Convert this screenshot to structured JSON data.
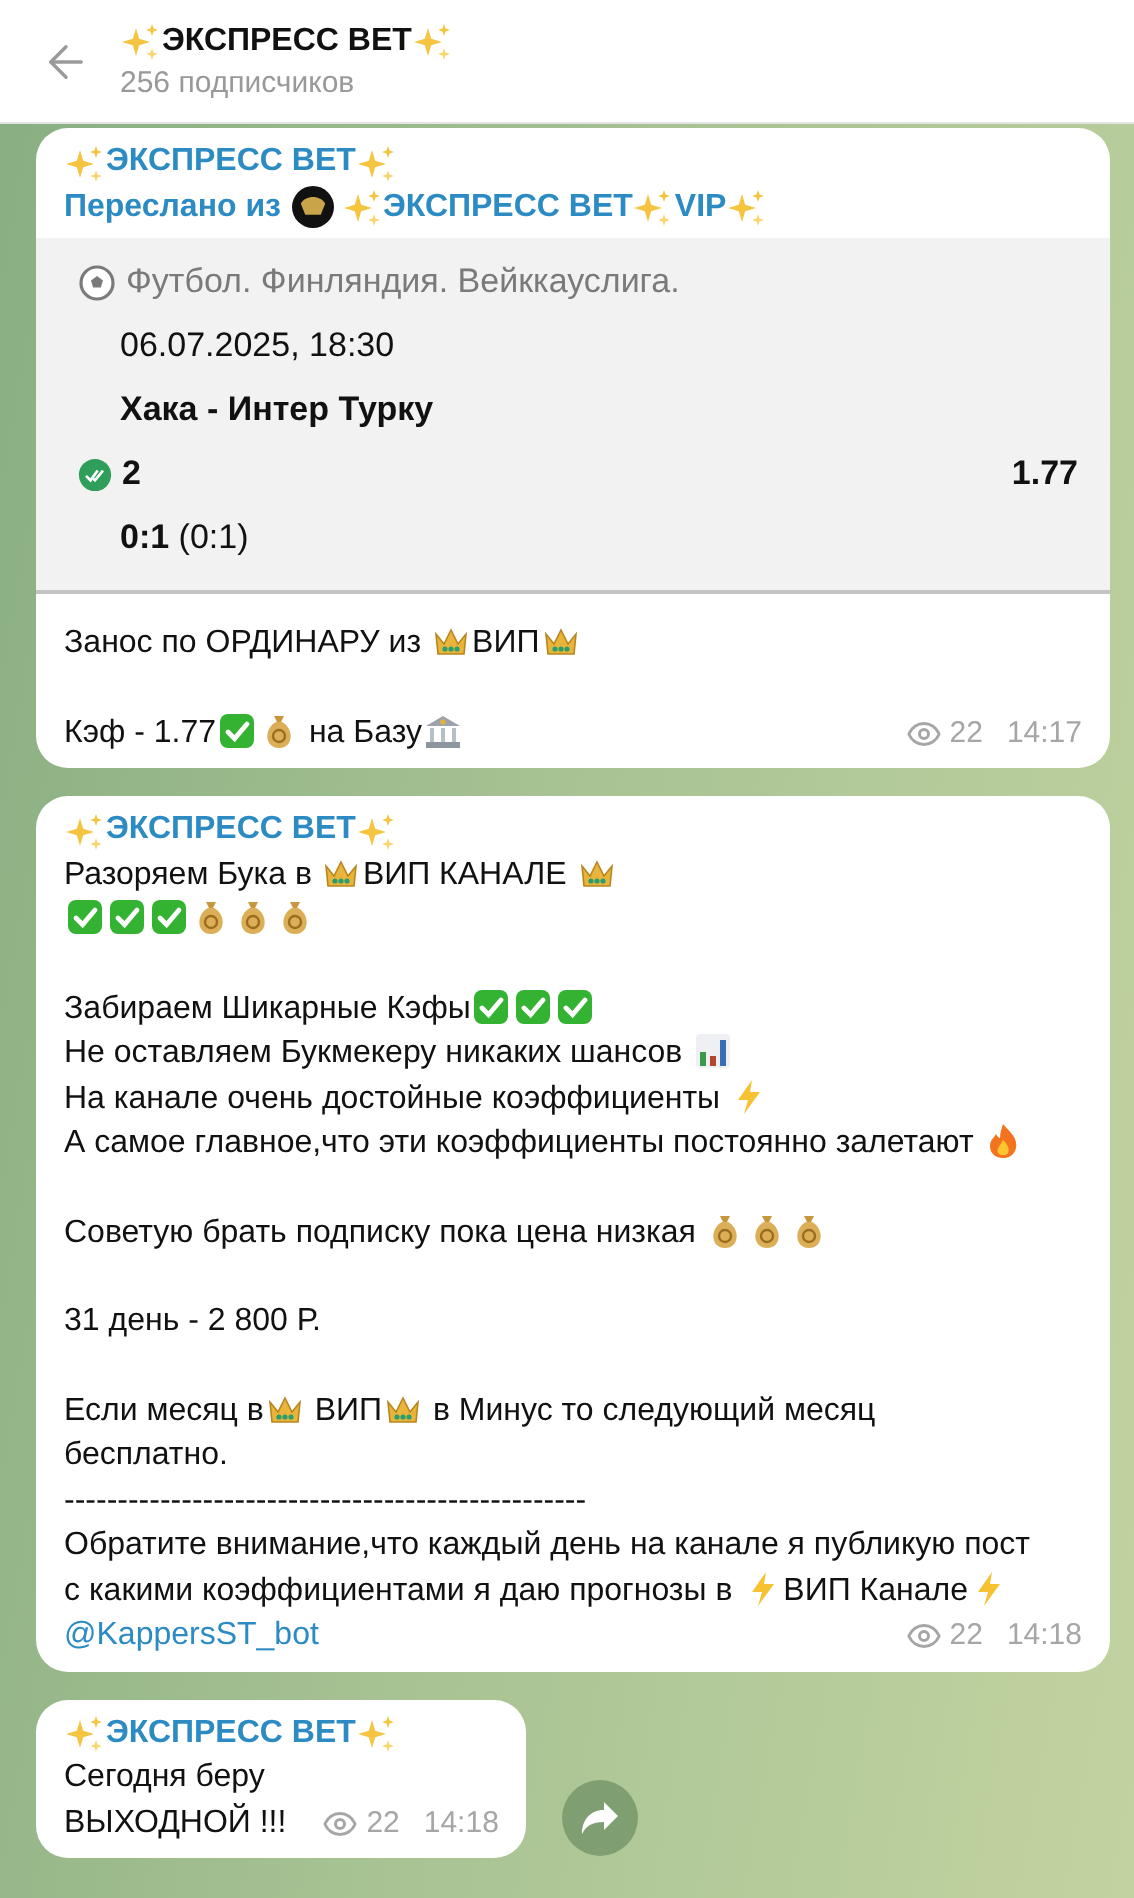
{
  "header": {
    "title": [
      {
        "kind": "sparkles"
      },
      " ЭКСПРЕСС ВЕТ",
      {
        "kind": "sparkles"
      }
    ],
    "subtitle": "256 подписчиков"
  },
  "messages": [
    {
      "author": [
        {
          "kind": "sparkles"
        },
        " ЭКСПРЕСС ВЕТ",
        {
          "kind": "sparkles"
        }
      ],
      "forwarded": {
        "label": "Переслано из",
        "source": [
          {
            "kind": "sparkles"
          },
          " ЭКСПРЕСС ВЕТ ",
          {
            "kind": "sparkles"
          },
          "VIP ",
          {
            "kind": "sparkles"
          }
        ]
      },
      "bet": {
        "league": "Футбол. Финляндия. Вейккауслига.",
        "date": "06.07.2025, 18:30",
        "match": "Хака - Интер Турку",
        "pick": "2",
        "odds": "1.77",
        "score": "**0:1** (0:1)"
      },
      "paragraphs": [
        [
          [
            "Занос по ОРДИНАРУ из ",
            {
              "kind": "crown"
            },
            "ВИП",
            {
              "kind": "crown"
            }
          ]
        ],
        [
          [
            "Кэф - 1.77",
            {
              "kind": "check"
            },
            {
              "kind": "moneybag"
            },
            " на Базу",
            {
              "kind": "bank"
            }
          ]
        ]
      ],
      "views": "22",
      "time": "14:17"
    },
    {
      "author": [
        {
          "kind": "sparkles"
        },
        " ЭКСПРЕСС ВЕТ",
        {
          "kind": "sparkles"
        }
      ],
      "paragraphs": [
        [
          [
            "Разоряем Бука в ",
            {
              "kind": "crown"
            },
            "ВИП КАНАЛЕ ",
            {
              "kind": "crown"
            }
          ],
          [
            {
              "kind": "check"
            },
            {
              "kind": "check"
            },
            {
              "kind": "check"
            },
            {
              "kind": "moneybag"
            },
            {
              "kind": "moneybag"
            },
            {
              "kind": "moneybag"
            }
          ]
        ],
        [
          [
            "Забираем Шикарные Кэфы",
            {
              "kind": "check"
            },
            {
              "kind": "check"
            },
            {
              "kind": "check"
            }
          ],
          [
            "Не оставляем Букмекеру никаких шансов ",
            {
              "kind": "chart"
            }
          ],
          [
            "На канале очень достойные коэффициенты ",
            {
              "kind": "zap"
            }
          ],
          [
            "А самое главное,что эти коэффициенты постоянно залетают ",
            {
              "kind": "fire"
            }
          ]
        ],
        [
          [
            "Советую брать подписку пока цена низкая ",
            {
              "kind": "moneybag"
            },
            {
              "kind": "moneybag"
            },
            {
              "kind": "moneybag"
            }
          ]
        ],
        [
          [
            "31 день - 2 800 Р."
          ]
        ],
        [
          [
            "Если месяц в",
            {
              "kind": "crown"
            },
            " ВИП",
            {
              "kind": "crown"
            },
            " в Минус то следующий месяц"
          ],
          [
            "бесплатно."
          ],
          [
            "-------------------------------------------------"
          ],
          [
            "Обратите внимание,что каждый день на канале я публикую пост"
          ],
          [
            "с какими коэффициентами я даю прогнозы в ",
            {
              "kind": "zap"
            },
            "ВИП Канале",
            {
              "kind": "zap"
            }
          ],
          [
            {
              "kind": "link",
              "text": "@KappersST_bot"
            }
          ]
        ]
      ],
      "views": "22",
      "time": "14:18"
    },
    {
      "author": [
        {
          "kind": "sparkles"
        },
        " ЭКСПРЕСС ВЕТ",
        {
          "kind": "sparkles"
        }
      ],
      "paragraphs": [
        [
          [
            "Сегодня беру"
          ],
          [
            "ВЫХОДНОЙ !!!"
          ]
        ]
      ],
      "views": "22",
      "time": "14:18"
    }
  ]
}
